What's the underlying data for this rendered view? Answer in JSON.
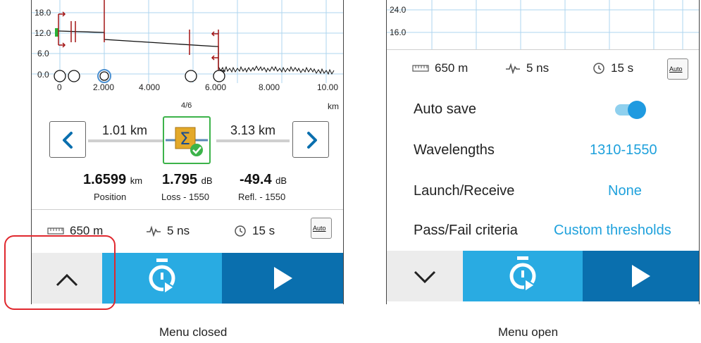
{
  "left_panel": {
    "chart": {
      "y_ticks": [
        "18.0",
        "12.0",
        "6.0",
        "0.0"
      ],
      "x_ticks": [
        "0",
        "2.000",
        "4.000",
        "6.000",
        "8.000",
        "10.00"
      ],
      "x_unit": "km",
      "trace_color": "#111111",
      "marker_color": "#a31515",
      "grid_color": "#aed4ef"
    },
    "event_counter": "4/6",
    "prev_distance": "1.01 km",
    "next_distance": "3.13 km",
    "measurements": [
      {
        "value": "1.6599",
        "unit": "km",
        "label": "Position"
      },
      {
        "value": "1.795",
        "unit": "dB",
        "label": "Loss - 1550"
      },
      {
        "value": "-49.4",
        "unit": "dB",
        "label": "Refl. - 1550"
      }
    ],
    "settings": {
      "distance": "650 m",
      "pulse": "5 ns",
      "time": "15 s",
      "auto_label": "Auto"
    }
  },
  "right_panel": {
    "chart": {
      "y_ticks": [
        "24.0",
        "16.0"
      ]
    },
    "settings": {
      "distance": "650 m",
      "pulse": "5 ns",
      "time": "15 s",
      "auto_label": "Auto"
    },
    "menu": [
      {
        "label": "Auto save",
        "type": "toggle",
        "on": true
      },
      {
        "label": "Wavelengths",
        "value": "1310-1550"
      },
      {
        "label": "Launch/Receive",
        "value": "None"
      },
      {
        "label": "Pass/Fail criteria",
        "value": "Custom thresholds"
      }
    ]
  },
  "captions": {
    "left": "Menu closed",
    "right": "Menu open"
  },
  "colors": {
    "accent": "#1fa1dc",
    "timer_button": "#29abe2",
    "play_button": "#0a6fae",
    "highlight": "#e0282e",
    "event_icon_border": "#3cb34a"
  }
}
